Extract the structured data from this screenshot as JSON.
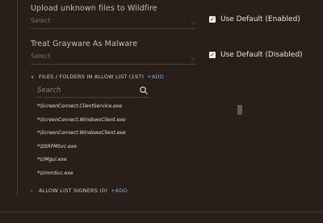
{
  "settings": [
    {
      "label": "Upload unknown files to Wildfire",
      "placeholder": "Select",
      "default_label": "Use Default (Enabled)"
    },
    {
      "label": "Treat Grayware As Malware",
      "placeholder": "Select",
      "default_label": "Use Default (Disabled)"
    }
  ],
  "allow_list": {
    "title": "FILES / FOLDERS IN ALLOW LIST (197)",
    "add_label": "+ADD",
    "search_placeholder": "Search",
    "files": [
      "*\\ScreenConnect.ClientService.exe",
      "*\\ScreenConnect.WindowsClient.exe",
      "*\\ScreenConnect.WindowsClient.exe",
      "*\\SSRPMSvc.exe",
      "*\\UMgui.exe",
      "*\\UmmSvc.exe"
    ]
  },
  "signers": {
    "title": "ALLOW LIST SIGNERS (0)",
    "add_label": "+ADD"
  },
  "icons": {
    "expanded": "chevron-down-icon",
    "collapsed": "chevron-right-icon",
    "search": "search-icon",
    "check": "check-icon"
  },
  "colors": {
    "background": "#2a1e19",
    "link": "#7fb4e6"
  }
}
